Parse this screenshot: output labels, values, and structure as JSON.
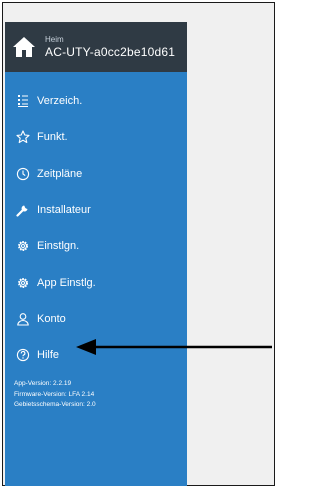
{
  "header": {
    "subtitle": "Heim",
    "device_name": "AC-UTY-a0cc2be10d61",
    "icon": "home-icon"
  },
  "menu": [
    {
      "label": "Verzeich.",
      "icon": "list-icon"
    },
    {
      "label": "Funkt.",
      "icon": "star-icon"
    },
    {
      "label": "Zeitpläne",
      "icon": "clock-icon"
    },
    {
      "label": "Installateur",
      "icon": "wrench-icon"
    },
    {
      "label": "Einstlgn.",
      "icon": "gear-icon"
    },
    {
      "label": "App Einstlg.",
      "icon": "gear-icon"
    },
    {
      "label": "Konto",
      "icon": "user-icon"
    },
    {
      "label": "Hilfe",
      "icon": "help-icon"
    }
  ],
  "versions": {
    "app": "App-Version: 2.2.19",
    "firmware": "Firmware-Version: LFA 2.14",
    "schema": "Gebietsschema-Version: 2.0"
  },
  "colors": {
    "drawer": "#2a7fc5",
    "header": "#2f3a44",
    "content": "#f0f0f0"
  }
}
